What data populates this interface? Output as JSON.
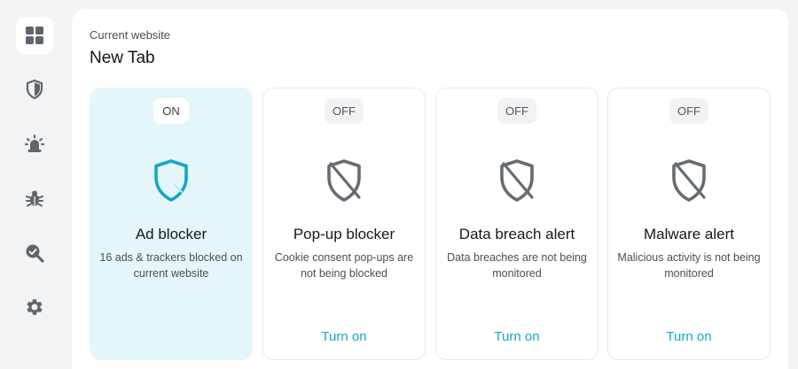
{
  "sidebar": {
    "items": [
      {
        "icon": "dashboard-icon",
        "active": true
      },
      {
        "icon": "shield-icon",
        "active": false
      },
      {
        "icon": "alarm-icon",
        "active": false
      },
      {
        "icon": "bug-icon",
        "active": false
      },
      {
        "icon": "search-scan-icon",
        "active": false
      },
      {
        "icon": "gear-icon",
        "active": false
      }
    ],
    "icon_color": "#5f656c"
  },
  "header": {
    "label": "Current website",
    "site": "New Tab"
  },
  "cards": [
    {
      "toggle": "ON",
      "title": "Ad blocker",
      "desc": "16 ads & trackers blocked on current website",
      "action": "",
      "state": "on"
    },
    {
      "toggle": "OFF",
      "title": "Pop-up blocker",
      "desc": "Cookie consent pop-ups are not being blocked",
      "action": "Turn on",
      "state": "off"
    },
    {
      "toggle": "OFF",
      "title": "Data breach alert",
      "desc": "Data breaches are not being monitored",
      "action": "Turn on",
      "state": "off"
    },
    {
      "toggle": "OFF",
      "title": "Malware alert",
      "desc": "Malicious activity is not being monitored",
      "action": "Turn on",
      "state": "off"
    }
  ],
  "colors": {
    "accent": "#13a7c7",
    "active_card_bg": "#e5f6fb",
    "off_icon": "#666c73"
  }
}
